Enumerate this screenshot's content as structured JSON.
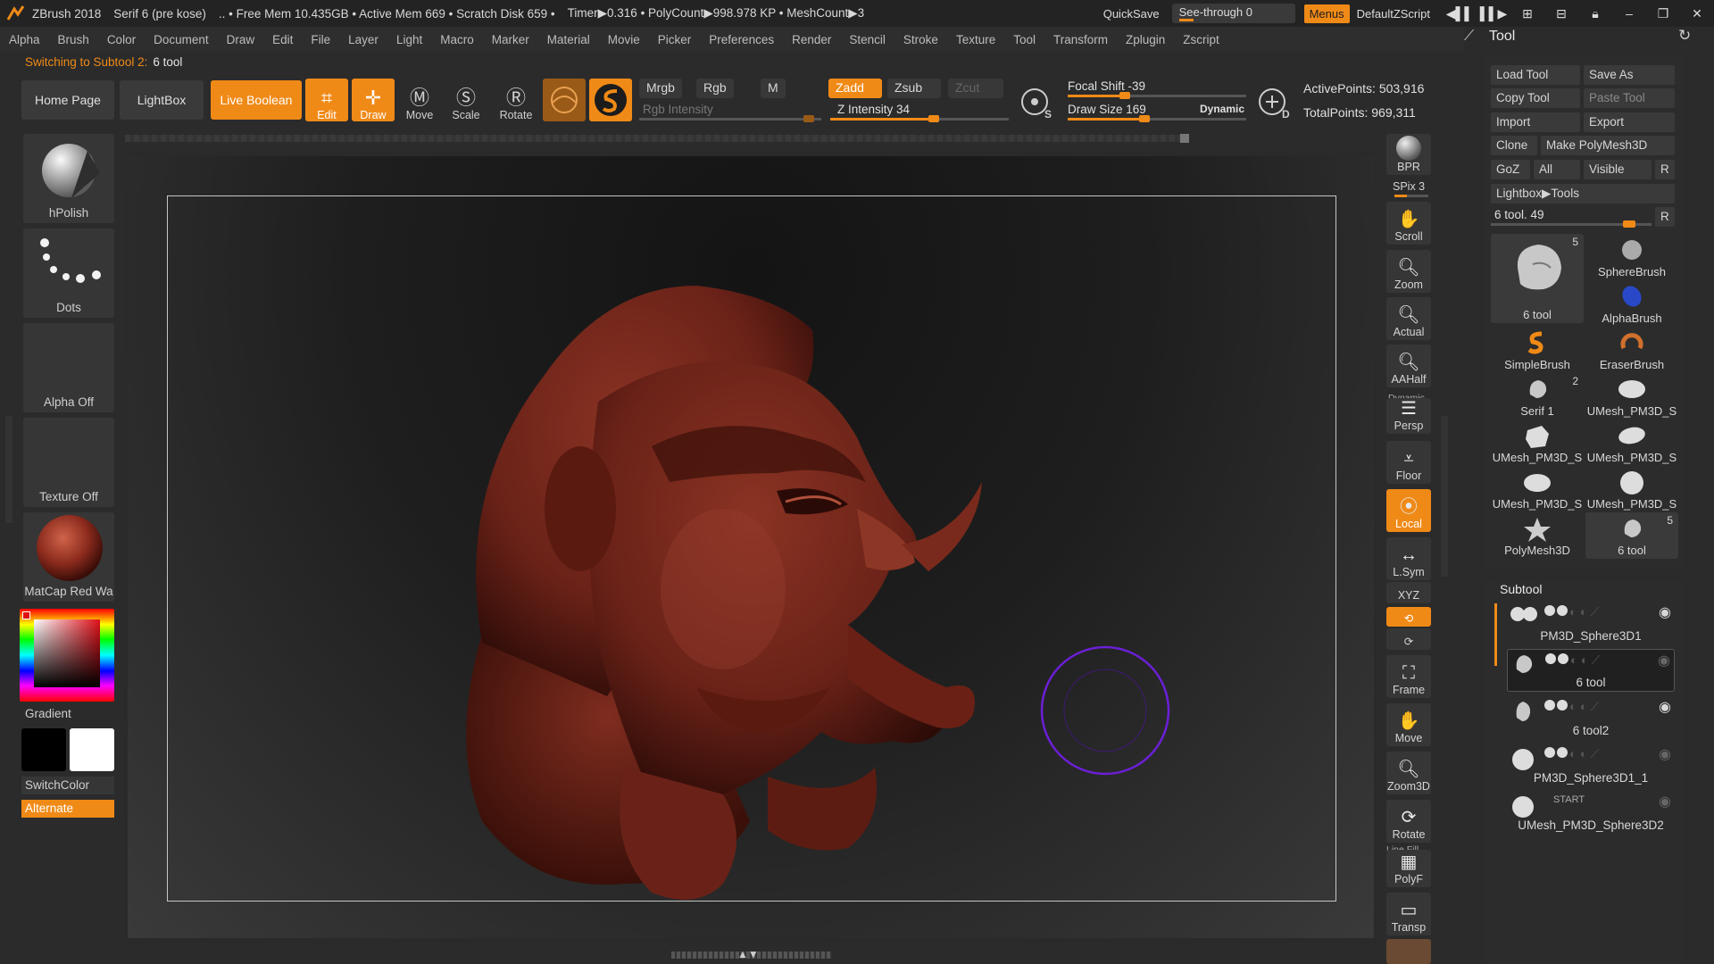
{
  "titlebar": {
    "app": "ZBrush 2018",
    "doc": "Serif 6 (pre kose)",
    "free_mem": ".. • Free Mem 10.435GB • Active Mem 669 • Scratch Disk 659 •",
    "timer": "Timer▶0.316 • PolyCount▶998.978 KP • MeshCount▶3",
    "quicksave": "QuickSave",
    "see_through": "See-through   0",
    "menus": "Menus",
    "default_zscript": "DefaultZScript"
  },
  "menubar": [
    "Alpha",
    "Brush",
    "Color",
    "Document",
    "Draw",
    "Edit",
    "File",
    "Layer",
    "Light",
    "Macro",
    "Marker",
    "Material",
    "Movie",
    "Picker",
    "Preferences",
    "Render",
    "Stencil",
    "Stroke",
    "Texture",
    "Tool",
    "Transform",
    "Zplugin",
    "Zscript"
  ],
  "status": {
    "prefix": "Switching to Subtool 2:",
    "value": "6 tool"
  },
  "toolbar": {
    "home": "Home Page",
    "lightbox": "LightBox",
    "live_boolean": "Live Boolean",
    "edit": "Edit",
    "draw": "Draw",
    "move": "Move",
    "scale": "Scale",
    "rotate": "Rotate",
    "mrgb": "Mrgb",
    "rgb": "Rgb",
    "m": "M",
    "rgb_intensity": "Rgb Intensity",
    "zadd": "Zadd",
    "zsub": "Zsub",
    "zcut": "Zcut",
    "z_intensity": "Z Intensity 34",
    "focal_shift": "Focal Shift -39",
    "draw_size": "Draw Size 169",
    "dynamic": "Dynamic",
    "active_points": "ActivePoints: 503,916",
    "total_points": "TotalPoints: 969,311",
    "z_intensity_value": 34,
    "draw_size_value": 169
  },
  "left_shelf": {
    "brush": "hPolish",
    "stroke": "Dots",
    "alpha": "Alpha Off",
    "texture": "Texture Off",
    "material": "MatCap Red Wa",
    "gradient": "Gradient",
    "switch_color": "SwitchColor",
    "alternate": "Alternate"
  },
  "right_shelf": {
    "bpr": "BPR",
    "spix": "SPix 3",
    "scroll": "Scroll",
    "zoom": "Zoom",
    "actual": "Actual",
    "aahalf": "AAHalf",
    "dynamic": "Dynamic",
    "persp": "Persp",
    "floor": "Floor",
    "local": "Local",
    "lsym": "L.Sym",
    "xyz": "XYZ",
    "frame": "Frame",
    "move": "Move",
    "zoom3d": "Zoom3D",
    "rotate": "Rotate",
    "line_fill": "Line Fill",
    "polyf": "PolyF",
    "transp": "Transp"
  },
  "tool_panel": {
    "title": "Tool",
    "load_tool": "Load Tool",
    "save_as": "Save As",
    "copy_tool": "Copy Tool",
    "paste_tool": "Paste Tool",
    "import": "Import",
    "export": "Export",
    "clone": "Clone",
    "make_polymesh": "Make PolyMesh3D",
    "goz": "GoZ",
    "all": "All",
    "visible": "Visible",
    "r": "R",
    "lightbox_tools": "Lightbox▶Tools",
    "tool_slider": "6 tool. 49",
    "tools": [
      {
        "name": "6 tool",
        "badge": "5"
      },
      {
        "name": "SphereBrush",
        "badge": ""
      },
      {
        "name": "AlphaBrush",
        "badge": ""
      },
      {
        "name": "SimpleBrush",
        "badge": ""
      },
      {
        "name": "EraserBrush",
        "badge": ""
      },
      {
        "name": "Serif 1",
        "badge": "2"
      },
      {
        "name": "UMesh_PM3D_S",
        "badge": ""
      },
      {
        "name": "UMesh_PM3D_S",
        "badge": ""
      },
      {
        "name": "UMesh_PM3D_S",
        "badge": ""
      },
      {
        "name": "UMesh_PM3D_S",
        "badge": ""
      },
      {
        "name": "UMesh_PM3D_S",
        "badge": ""
      },
      {
        "name": "PolyMesh3D",
        "badge": ""
      },
      {
        "name": "6 tool",
        "badge": "5"
      }
    ]
  },
  "subtool": {
    "title": "Subtool",
    "items": [
      {
        "name": "PM3D_Sphere3D1"
      },
      {
        "name": "6 tool"
      },
      {
        "name": "6 tool2"
      },
      {
        "name": "PM3D_Sphere3D1_1"
      },
      {
        "name": "UMesh_PM3D_Sphere3D2"
      }
    ],
    "start_label": "START"
  },
  "colors": {
    "accent": "#f08a17",
    "model": "#7a2a1f",
    "brush_circle": "#6b1fd6"
  }
}
